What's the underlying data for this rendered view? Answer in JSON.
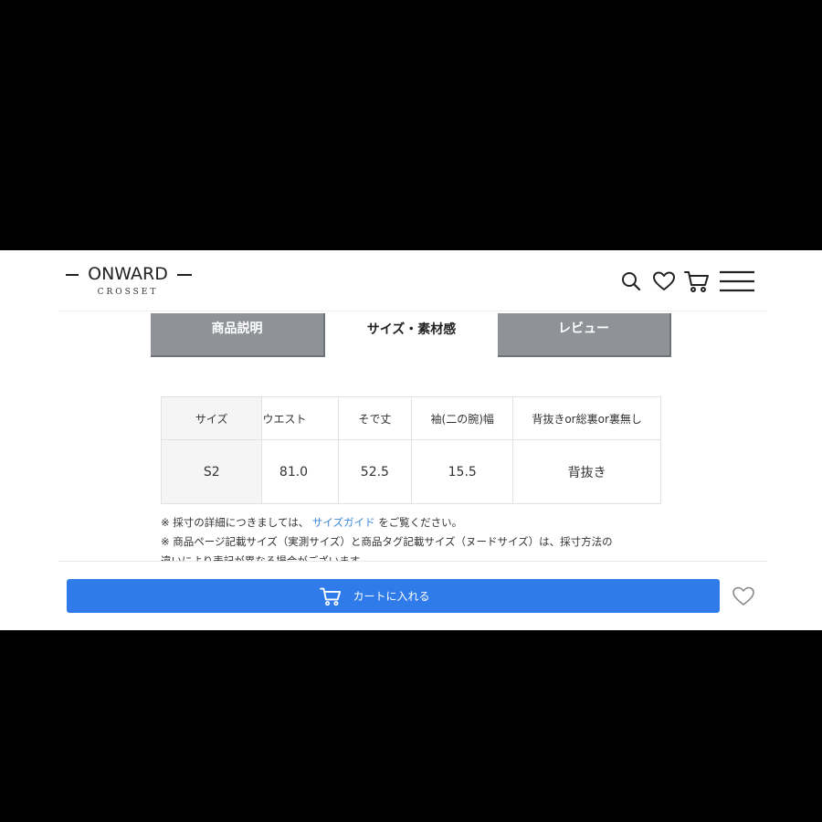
{
  "brand": {
    "name": "ONWARD",
    "sub": "CROSSET"
  },
  "header": {
    "icons": [
      "search-icon",
      "heart-icon",
      "cart-icon",
      "menu-icon"
    ]
  },
  "tabs": [
    {
      "label": "商品説明",
      "active": false
    },
    {
      "label": "サイズ・素材感",
      "active": true
    },
    {
      "label": "レビュー",
      "active": false
    }
  ],
  "size_table": {
    "headers": [
      "サイズ",
      "ウエスト",
      "そで丈",
      "袖(二の腕)幅",
      "背抜きor総裏or裏無し"
    ],
    "rows": [
      [
        "S2",
        "81.0",
        "52.5",
        "15.5",
        "背抜き"
      ]
    ]
  },
  "notes": {
    "line1_prefix": "※ 採寸の詳細につきましては、",
    "line1_link": "サイズガイド",
    "line1_suffix": "をご覧ください。",
    "line2": "※ 商品ページ記載サイズ（実測サイズ）と商品タグ記載サイズ（ヌードサイズ）は、採寸方法の",
    "line3": "違いにより表記が異なる場合がございます。"
  },
  "bottom_bar": {
    "cart_label": "カートに入れる"
  },
  "colors": {
    "accent": "#2f7bea",
    "tab_inactive": "#8f9297",
    "link": "#3a86d8"
  }
}
